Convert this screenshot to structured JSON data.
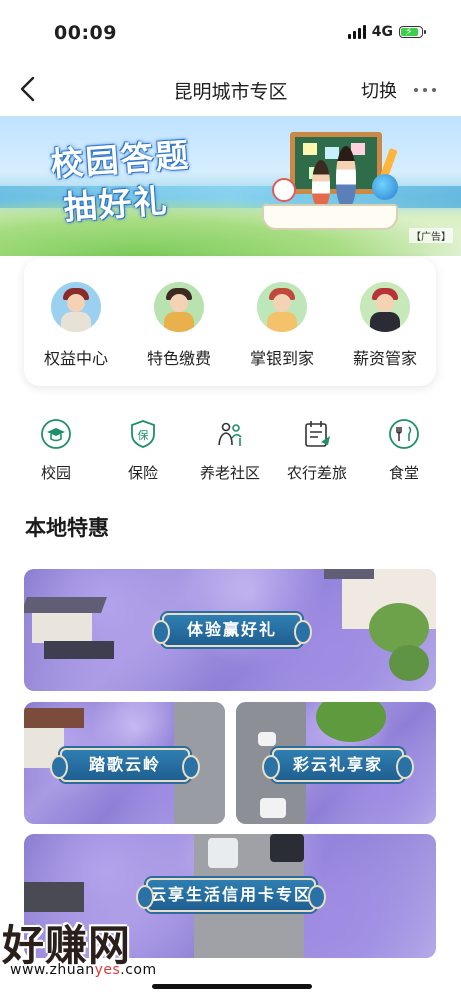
{
  "status_bar": {
    "time": "00:09",
    "network": "4G"
  },
  "nav": {
    "title": "昆明城市专区",
    "switch_label": "切换"
  },
  "banner": {
    "title_line1": "校园答题",
    "title_line2": "抽好礼",
    "ad_tag": "【广告】"
  },
  "services": [
    {
      "label": "权益中心",
      "icon": "avatar-rights-center-icon",
      "color": "#9bd1f0"
    },
    {
      "label": "特色缴费",
      "icon": "avatar-payment-icon",
      "color": "#b8e2b0"
    },
    {
      "label": "掌银到家",
      "icon": "avatar-delivery-icon",
      "color": "#bde7b8"
    },
    {
      "label": "薪资管家",
      "icon": "avatar-salary-icon",
      "color": "#c7e8b9"
    }
  ],
  "quick_entries": [
    {
      "label": "校园",
      "icon": "graduation-cap-icon"
    },
    {
      "label": "保险",
      "icon": "shield-insurance-icon",
      "glyph": "保"
    },
    {
      "label": "养老社区",
      "icon": "elderly-community-icon"
    },
    {
      "label": "农行差旅",
      "icon": "travel-calendar-icon"
    },
    {
      "label": "食堂",
      "icon": "canteen-icon"
    }
  ],
  "section": {
    "title": "本地特惠"
  },
  "promos": [
    {
      "label": "体验赢好礼"
    },
    {
      "label": "踏歌云岭"
    },
    {
      "label": "彩云礼享家"
    },
    {
      "label": "云享生活信用卡专区"
    }
  ],
  "watermark": {
    "brand": "好赚网",
    "url_prefix": "www.zhuan",
    "url_accent": "yes",
    "url_suffix": ".com"
  },
  "colors": {
    "accent_green": "#1f8f6a",
    "ribbon_blue": "#1f5f91",
    "jacaranda_purple": "#8e7fd6"
  }
}
